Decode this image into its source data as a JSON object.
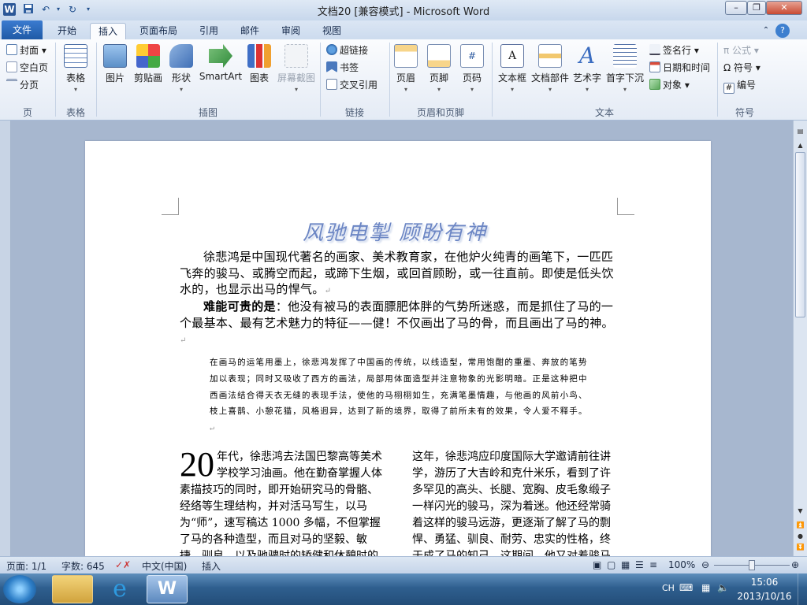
{
  "window": {
    "title": "文档20 [兼容模式] - Microsoft Word",
    "controls": [
      "–",
      "❐",
      "✕"
    ]
  },
  "quick_access": {
    "save": "save-icon",
    "undo": "undo-icon",
    "redo": "redo-icon",
    "customize": "▾"
  },
  "tabs": [
    {
      "label": "文件"
    },
    {
      "label": "开始"
    },
    {
      "label": "插入"
    },
    {
      "label": "页面布局"
    },
    {
      "label": "引用"
    },
    {
      "label": "邮件"
    },
    {
      "label": "审阅"
    },
    {
      "label": "视图"
    }
  ],
  "ribbon": {
    "pages": {
      "cover": "封面",
      "blank": "空白页",
      "break": "分页",
      "group": "页"
    },
    "tables": {
      "table": "表格",
      "group": "表格"
    },
    "illustrations": {
      "picture": "图片",
      "clipart": "剪贴画",
      "shapes": "形状",
      "smartart": "SmartArt",
      "chart": "图表",
      "screenshot": "屏幕截图",
      "group": "插图"
    },
    "links": {
      "hyperlink": "超链接",
      "bookmark": "书签",
      "crossref": "交叉引用",
      "group": "链接"
    },
    "header_footer": {
      "header": "页眉",
      "footer": "页脚",
      "pagenum": "页码",
      "group": "页眉和页脚"
    },
    "text": {
      "textbox": "文本框",
      "quickparts": "文档部件",
      "wordart": "艺术字",
      "dropcap": "首字下沉",
      "signature": "签名行",
      "datetime": "日期和时间",
      "object": "对象",
      "group": "文本"
    },
    "symbols": {
      "equation": "π 公式",
      "symbol": "Ω 符号",
      "number": "编号",
      "group": "符号"
    }
  },
  "document": {
    "wordart": "风驰电掣 顾盼有神",
    "para1": "徐悲鸿是中国现代著名的画家、美术教育家，在他炉火纯青的画笔下，一匹匹飞奔的骏马、或腾空而起，或蹄下生烟，或回首顾盼，或一往直前。即使是低头饮水的，也显示出马的悍气。",
    "para2_bold": "难能可贵的是",
    "para2_rest": "：他没有被马的表面膘肥体胖的气势所迷惑，而是抓住了马的一个最基本、最有艺术魅力的特征——健！不仅画出了马的骨，而且画出了马的神。",
    "quote": "在画马的运笔用墨上，徐悲鸿发挥了中国画的传统，以线造型，常用饱酣的重墨、奔放的笔势加以表现；同时又吸收了西方的画法，局部用体面造型并注意物象的光影明暗。正是这种把中西画法结合得天衣无缝的表现手法，使他的马栩栩如生，充满笔墨情趣，与他画的风前小鸟、枝上喜鹊、小憩花猫，风格迥异，达到了新的境界，取得了前所未有的效果，令人爱不释手。",
    "col1_dropcap": "20",
    "col1": "年代，徐悲鸿去法国巴黎高等美术学校学习油画。他在勤奋掌握人体素描技巧的同时，即开始研究马的骨骼、经络等生理结构，并对活马写生，以马为“师”，速写稿达 1000 多幅，不但掌握了马的各种造型，而且对马的坚毅、敏捷、驯良，以及驰骋时的矫健和休憩时的安静",
    "col2": "这年，徐悲鸿应印度国际大学邀请前往讲学，游历了大吉岭和克什米乐，看到了许多罕见的高头、长腿、宽胸、皮毛象缎子一样闪光的骏马，深为着迷。他还经常骑着这样的骏马远游，更逐渐了解了马的剽悍、勇猛、驯良、耐劳、忠实的性格，终于成了马的知己。这期间，他又对着骏马"
  },
  "status": {
    "page": "页面: 1/1",
    "words": "字数: 645",
    "language": "中文(中国)",
    "mode": "插入",
    "zoom": "100%"
  },
  "taskbar": {
    "ime": "CH",
    "time": "15:06",
    "date": "2013/10/16"
  },
  "colors": {
    "accent": "#1f5aa6",
    "wordart": "#6c86c4"
  }
}
